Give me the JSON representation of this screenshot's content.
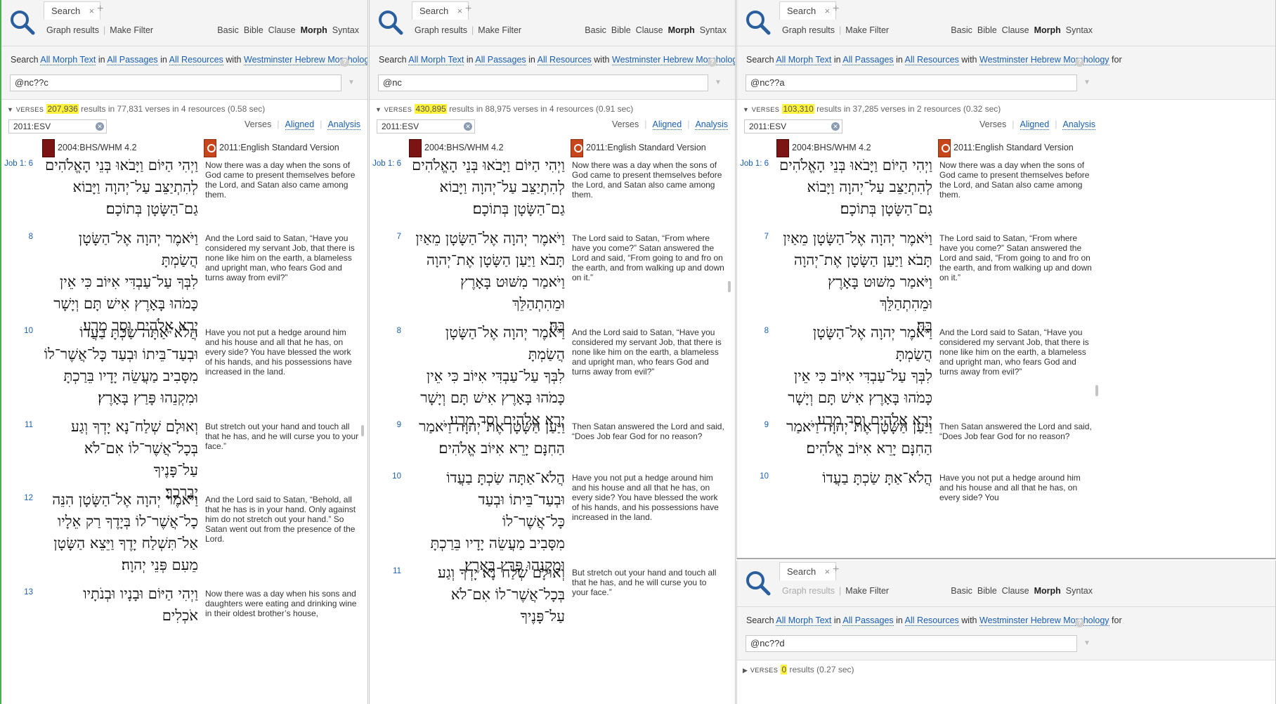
{
  "tabs": {
    "search_label": "Search",
    "close": "×",
    "add": "+"
  },
  "toolbar": {
    "graph_results": "Graph results",
    "make_filter": "Make Filter",
    "modes": [
      "Basic",
      "Bible",
      "Clause",
      "Morph",
      "Syntax"
    ]
  },
  "search": {
    "prefix": "Search",
    "what": "All Morph Text",
    "in_word": "in",
    "where": "All Passages",
    "in_word2": "in",
    "resources": "All Resources",
    "with_word": "with",
    "morphology": "Westminster Hebrew Morphology",
    "for_word": "for",
    "help": "?"
  },
  "verses_label": "VERSES",
  "resource_filter": "2011:ESV",
  "result_views": [
    "Verses",
    "Aligned",
    "Analysis"
  ],
  "resource_heads": {
    "hebrew": "2004:BHS/WHM 4.2",
    "english": "2011:English Standard Version"
  },
  "panes": [
    {
      "query": "@nc??c",
      "count": "207,936",
      "summary": " results in 77,831 verses in 4 resources (0.58 sec)",
      "verses": [
        {
          "ref": "Job 1:  6",
          "eng": "Now there was a day when the sons of God came to present themselves before the Lord, and Satan also came among them."
        },
        {
          "ref": "8",
          "eng": "And the Lord said to Satan, “Have you considered my servant Job, that there is none like him on the earth, a blameless and upright man, who fears God and turns away from evil?”"
        },
        {
          "ref": "10",
          "eng": "Have you not put a hedge around him and his house and all that he has, on every side? You have blessed the work of his hands, and his possessions have increased in the land."
        },
        {
          "ref": "11",
          "eng": "But stretch out your hand and touch all that he has, and he will curse you to your face.”"
        },
        {
          "ref": "12",
          "eng": "And the Lord said to Satan, “Behold, all that he has is in your hand. Only against him do not stretch out your hand.” So Satan went out from the presence of the Lord."
        },
        {
          "ref": "13",
          "eng": "Now there was a day when his sons and daughters were eating and drinking wine in their oldest brother’s house,"
        }
      ]
    },
    {
      "query": "@nc",
      "count": "430,895",
      "summary": " results in 88,975 verses in 4 resources (0.91 sec)",
      "verses": [
        {
          "ref": "Job 1:  6",
          "eng": "Now there was a day when the sons of God came to present themselves before the Lord, and Satan also came among them."
        },
        {
          "ref": "7",
          "eng": "The Lord said to Satan, “From where have you come?” Satan answered the Lord and said, “From going to and fro on the earth, and from walking up and down on it.”"
        },
        {
          "ref": "8",
          "eng": "And the Lord said to Satan, “Have you considered my servant Job, that there is none like him on the earth, a blameless and upright man, who fears God and turns away from evil?”"
        },
        {
          "ref": "9",
          "eng": "Then Satan answered the Lord and said, “Does Job fear God for no reason?"
        },
        {
          "ref": "10",
          "eng": "Have you not put a hedge around him and his house and all that he has, on every side? You have blessed the work of his hands, and his possessions have increased in the land."
        },
        {
          "ref": "11",
          "eng": "But stretch out your hand and touch all that he has, and he will curse you to your face.”"
        }
      ]
    },
    {
      "query": "@nc??a",
      "count": "103,310",
      "summary": " results in 37,285 verses in 2 resources (0.32 sec)",
      "verses": [
        {
          "ref": "Job 1:  6",
          "eng": "Now there was a day when the sons of God came to present themselves before the Lord, and Satan also came among them."
        },
        {
          "ref": "7",
          "eng": "The Lord said to Satan, “From where have you come?” Satan answered the Lord and said, “From going to and fro on the earth, and from walking up and down on it.”"
        },
        {
          "ref": "8",
          "eng": "And the Lord said to Satan, “Have you considered my servant Job, that there is none like him on the earth, a blameless and upright man, who fears God and turns away from evil?”"
        },
        {
          "ref": "9",
          "eng": "Then Satan answered the Lord and said, “Does Job fear God for no reason?"
        },
        {
          "ref": "10",
          "eng": "Have you not put a hedge around him and his house and all that he has, on every side? You"
        }
      ]
    },
    {
      "query": "@nc??d",
      "count": "0",
      "summary": " results (0.27 sec)",
      "verses": []
    }
  ],
  "hebrew": {
    "v6": [
      "וַיְהִי הַיּוֹם וַיָּבֹאוּ בְּנֵי הָאֱלֹהִים",
      "לְהִתְיַצֵּב עַל־יְהוָה וַיָּבוֹא",
      "גַם־הַשָּׂטָן בְּתוֹכָם׃"
    ],
    "v7": [
      "וַיֹּאמֶר יְהוָה אֶל־הַשָּׂטָן מֵאַיִן",
      "תָּבֹא וַיַּעַן הַשָּׂטָן אֶת־יְהוָה",
      "וַיֹּאמַר מִשּׁוּט בָּאָרֶץ וּמֵהִתְהַלֵּךְ",
      "בָּהּ׃"
    ],
    "v8": [
      "וַיֹּאמֶר יְהוָה אֶל־הַשָּׂטָן הֲשַׂמְתָּ",
      "לִבְּךָ עַל־עַבְדִּי אִיּוֹב כִּי אֵין",
      "כָּמֹהוּ בָּאָרֶץ אִישׁ תָּם וְיָשָׁר",
      "יְרֵא אֱלֹהִים וְסָר מֵרָע׃"
    ],
    "v9": [
      "וַיַּעַן הַשָּׂטָן אֶת־יְהוָה וַיֹּאמַר",
      "הַחִנָּם יָרֵא אִיּוֹב אֱלֹהִים׃"
    ],
    "v10": [
      "הֲלֹא־אַתָּה שַׂכְתָּ בַעֲדוֹ",
      "וּבְעַד־בֵּיתוֹ וּבְעַד כָּל־אֲשֶׁר־לוֹ",
      "מִסָּבִיב מַעֲשֵׂה יָדָיו בֵּרַכְתָּ",
      "וּמִקְנֵהוּ פָּרַץ בָּאָרֶץ׃"
    ],
    "v11": [
      "וְאוּלָם שְׁלַח־נָא יָדְךָ וְגַע",
      "בְּכָל־אֲשֶׁר־לוֹ אִם־לֹא עַל־פָּנֶיךָ",
      "יְבָרְכֶךָּ׃"
    ],
    "v12": [
      "וַיֹּאמֶר יְהוָה אֶל־הַשָּׂטָן הִנֵּה",
      "כָל־אֲשֶׁר־לוֹ בְּיָדֶךָ רַק אֵלָיו",
      "אַל־תִּשְׁלַח יָדֶךָ וַיֵּצֵא הַשָּׂטָן",
      "מֵעִם פְּנֵי יְהוָה׃"
    ],
    "v13": [
      "וַיְהִי הַיּוֹם וּבָנָיו וּבְנֹתָיו אֹכְלִים"
    ],
    "v10a": [
      "הֲלֹא־אַתָּ שַׂכְתָּ בַעֲדוֹ"
    ]
  }
}
